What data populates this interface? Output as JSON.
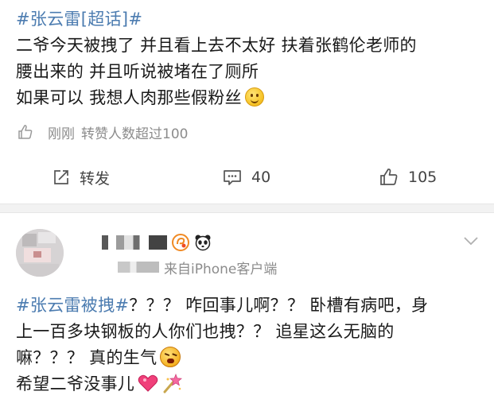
{
  "post1": {
    "lines": [
      "#张云雷[超话]#",
      "二爷今天被拽了 并且看上去不太好 扶着张鹤伦老师的",
      "腰出来的 并且听说被堵在了厕所",
      "如果可以 我想人肉那些假粉丝"
    ],
    "meta_time": "刚刚",
    "meta_stat": "转赞人数超过100",
    "actions": {
      "repost_label": "转发",
      "comment_count": "40",
      "like_count": "105"
    }
  },
  "post2": {
    "source": "来自iPhone客户端",
    "lines": [
      {
        "topic": "#张云雷被拽#",
        "rest": "？？？ 咋回事儿啊？？ 卧槽有病吧，身"
      },
      {
        "text": "上一百多块钢板的人你们也拽？？ 追星这么无脑的"
      },
      {
        "text": "嘛？？？ 真的生气"
      },
      {
        "text": "希望二爷没事儿"
      }
    ]
  },
  "colors": {
    "topic_blue": "#4c7cb0",
    "text": "#1a1a1a",
    "meta_gray": "#8c8c8c",
    "separator": "#f2f2f2"
  },
  "icons": {
    "meta": "like-outline-icon",
    "repost": "repost-icon",
    "comment": "comment-icon",
    "like": "like-icon",
    "menu": "chevron-down-icon"
  }
}
